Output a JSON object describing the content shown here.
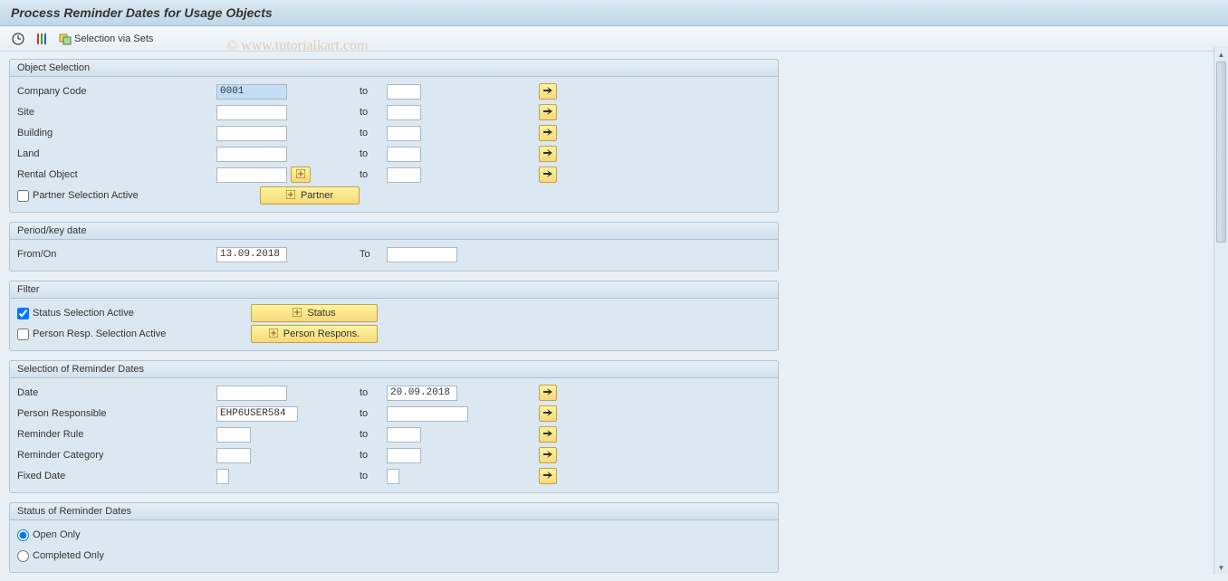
{
  "title": "Process Reminder Dates for Usage Objects",
  "watermark": "© www.tutorialkart.com",
  "toolbar": {
    "selection_via_sets": "Selection via Sets"
  },
  "groups": {
    "object_selection": {
      "title": "Object Selection",
      "company_code": {
        "label": "Company Code",
        "from": "0001",
        "to_label": "to",
        "to": ""
      },
      "site": {
        "label": "Site",
        "from": "",
        "to_label": "to",
        "to": ""
      },
      "building": {
        "label": "Building",
        "from": "",
        "to_label": "to",
        "to": ""
      },
      "land": {
        "label": "Land",
        "from": "",
        "to_label": "to",
        "to": ""
      },
      "rental_object": {
        "label": "Rental Object",
        "from": "",
        "to_label": "to",
        "to": ""
      },
      "partner_selection_active": {
        "label": "Partner Selection Active",
        "checked": false
      },
      "partner_btn": "Partner"
    },
    "period": {
      "title": "Period/key date",
      "from_on": {
        "label": "From/On",
        "from": "13.09.2018",
        "to_label": "To",
        "to": ""
      }
    },
    "filter": {
      "title": "Filter",
      "status_selection_active": {
        "label": "Status Selection Active",
        "checked": true
      },
      "status_btn": "Status",
      "person_resp_selection_active": {
        "label": "Person Resp. Selection Active",
        "checked": false
      },
      "person_respons_btn": "Person Respons."
    },
    "selection_reminder": {
      "title": "Selection of Reminder Dates",
      "date": {
        "label": "Date",
        "from": "",
        "to_label": "to",
        "to": "20.09.2018"
      },
      "person_responsible": {
        "label": "Person Responsible",
        "from": "EHP6USER584",
        "to_label": "to",
        "to": ""
      },
      "reminder_rule": {
        "label": "Reminder Rule",
        "from": "",
        "to_label": "to",
        "to": ""
      },
      "reminder_category": {
        "label": "Reminder Category",
        "from": "",
        "to_label": "to",
        "to": ""
      },
      "fixed_date": {
        "label": "Fixed Date",
        "from": "",
        "to_label": "to",
        "to": ""
      }
    },
    "status_reminder": {
      "title": "Status of Reminder Dates",
      "open_only": {
        "label": "Open Only",
        "checked": true
      },
      "completed_only": {
        "label": "Completed Only",
        "checked": false
      }
    }
  }
}
